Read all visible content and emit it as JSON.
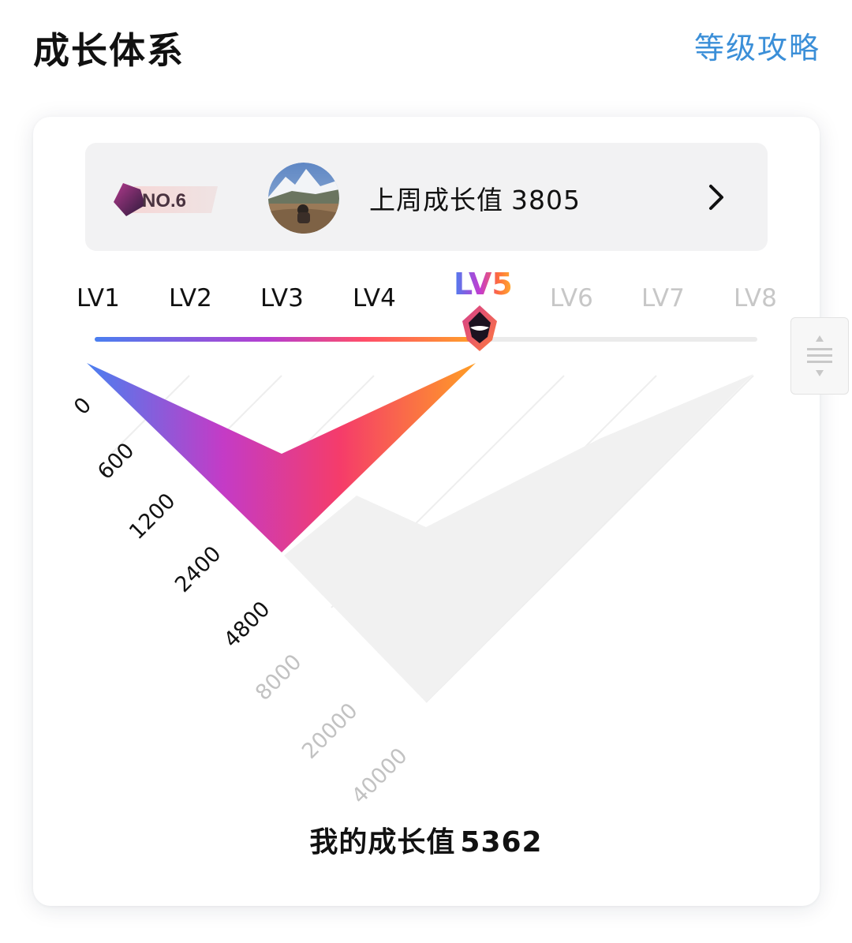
{
  "header": {
    "title": "成长体系",
    "guide_link": "等级攻略"
  },
  "weekly": {
    "rank_label": "NO.6",
    "label": "上周成长值",
    "value": "3805"
  },
  "levels": {
    "items": [
      "LV1",
      "LV2",
      "LV3",
      "LV4",
      "LV5",
      "LV6",
      "LV7",
      "LV8"
    ],
    "current": "LV5",
    "progress_fraction": 0.58
  },
  "thresholds": [
    "0",
    "600",
    "1200",
    "2400",
    "4800",
    "8000",
    "20000",
    "40000"
  ],
  "my_growth": {
    "label": "我的成长值",
    "value": "5362"
  },
  "colors": {
    "accent_link": "#3b8fd8",
    "gradient": [
      "#4a7ff0",
      "#c43bd0",
      "#ff4d6a",
      "#ffa326"
    ],
    "inactive": "#c7c7c7"
  }
}
